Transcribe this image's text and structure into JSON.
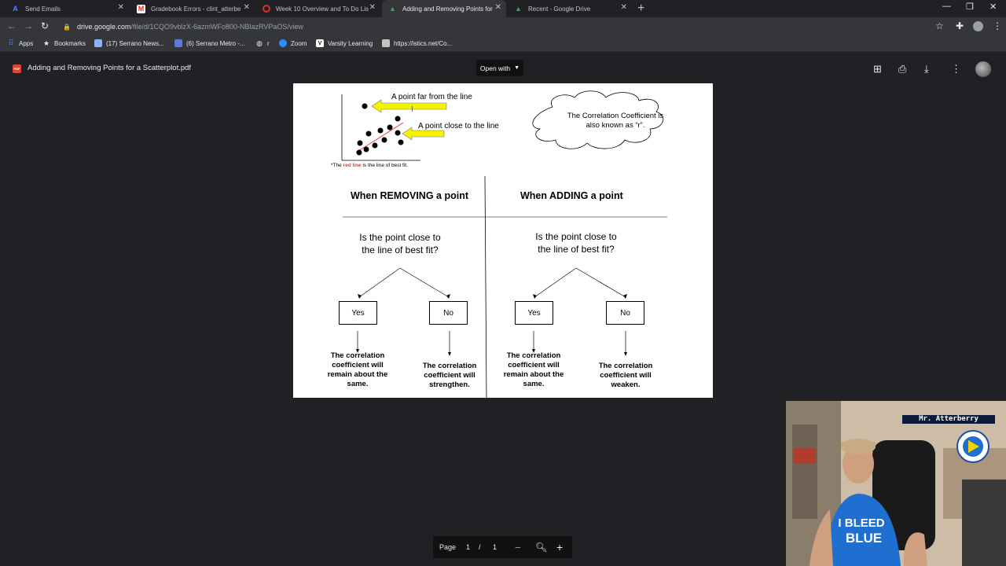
{
  "browser": {
    "tabs": [
      {
        "label": "Send Emails",
        "icon": "acellus-icon"
      },
      {
        "label": "Gradebook Errors - clint_atterbe",
        "icon": "gmail-icon"
      },
      {
        "label": "Week 10 Overview and To Do Lis",
        "icon": "loading-icon"
      },
      {
        "label": "Adding and Removing Points for",
        "icon": "drive-icon"
      },
      {
        "label": "Recent - Google Drive",
        "icon": "drive-icon"
      }
    ],
    "url_host": "drive.google.com",
    "url_path": "/file/d/1CQO9vblzX-6azmWFo800-NBlazRVPaOS/view",
    "bookmarks": [
      "Apps",
      "Bookmarks",
      "(17) Serrano News...",
      "(6) Serrano Metro -...",
      "r",
      "Zoom",
      "Varsity Learning",
      "https://istics.net/Co..."
    ]
  },
  "viewer": {
    "file_badge": "PDF",
    "file_title": "Adding and Removing Points for a Scatterplot.pdf",
    "open_with": "Open with",
    "page_label": "Page",
    "page_current": "1",
    "page_sep": "/",
    "page_total": "1"
  },
  "document": {
    "far_label": "A point far from the line",
    "close_label": "A point close to the line",
    "footnote_pre": "*The ",
    "footnote_red": "red line",
    "footnote_post": " is the line of best fit.",
    "cloud_text_1": "The Correlation Coefficient is",
    "cloud_text_2": "also known as “r”.",
    "left_heading": "When REMOVING a point",
    "right_heading": "When ADDING a point",
    "question_1": "Is the point close to",
    "question_2": "the line of best fit?",
    "yes": "Yes",
    "no": "No",
    "remove_yes_result": [
      "The correlation",
      "coefficient will",
      "remain about the",
      "same."
    ],
    "remove_no_result": [
      "The correlation",
      "coefficient will",
      "strengthen."
    ],
    "add_yes_result": [
      "The correlation",
      "coefficient will",
      "remain about the",
      "same."
    ],
    "add_no_result": [
      "The correlation",
      "coefficient will",
      "weaken."
    ]
  },
  "webcam": {
    "name_tag": "Mr. Atterberry",
    "shirt_text_1": "I BLEED",
    "shirt_text_2": "BLUE"
  },
  "colors": {
    "arrow_yellow": "#f3f300",
    "best_fit_red": "#e53935",
    "pdf_red": "#db4437"
  }
}
